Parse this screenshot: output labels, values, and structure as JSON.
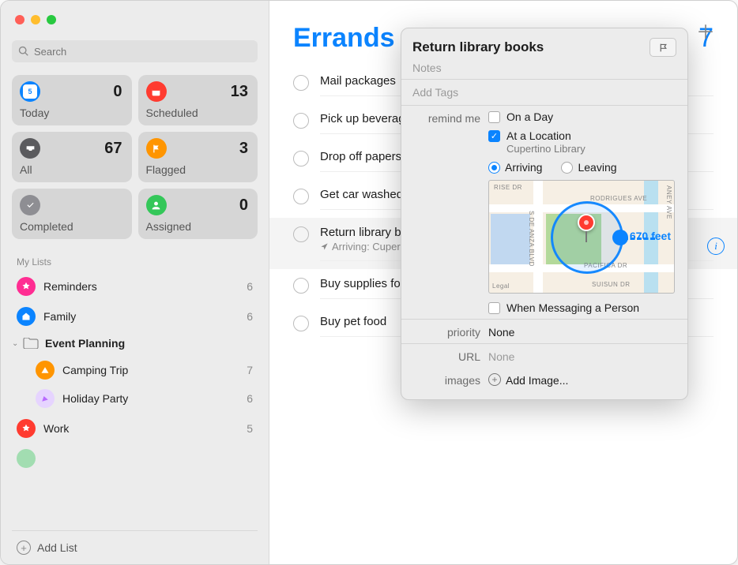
{
  "search": {
    "placeholder": "Search"
  },
  "smartLists": {
    "today": {
      "label": "Today",
      "count": "0"
    },
    "scheduled": {
      "label": "Scheduled",
      "count": "13"
    },
    "all": {
      "label": "All",
      "count": "67"
    },
    "flagged": {
      "label": "Flagged",
      "count": "3"
    },
    "completed": {
      "label": "Completed",
      "count": ""
    },
    "assigned": {
      "label": "Assigned",
      "count": "0"
    }
  },
  "sidebar": {
    "sectionLabel": "My Lists",
    "lists": {
      "reminders": {
        "name": "Reminders",
        "count": "6"
      },
      "family": {
        "name": "Family",
        "count": "6"
      },
      "camping": {
        "name": "Camping Trip",
        "count": "7"
      },
      "holiday": {
        "name": "Holiday Party",
        "count": "6"
      },
      "work": {
        "name": "Work",
        "count": "5"
      }
    },
    "folder": {
      "name": "Event Planning"
    },
    "addList": "Add List"
  },
  "main": {
    "title": "Errands",
    "count": "7",
    "tasks": {
      "t1": "Mail packages",
      "t2": "Pick up beverages",
      "t3": "Drop off papers",
      "t4": "Get car washed",
      "t5": "Return library books",
      "t5sub": "Arriving: Cupertino Library",
      "t6": "Buy supplies for trip",
      "t7": "Buy pet food"
    }
  },
  "popover": {
    "title": "Return library books",
    "notesPlaceholder": "Notes",
    "tagsPlaceholder": "Add Tags",
    "remindLabel": "remind me",
    "onDay": "On a Day",
    "atLocation": "At a Location",
    "locationName": "Cupertino Library",
    "arriving": "Arriving",
    "leaving": "Leaving",
    "distance": "670 feet",
    "roads": {
      "r1": "RISE DR",
      "r2": "RODRIGUES AVE",
      "r3": "PACIFICA DR",
      "r4": "S DE ANZA BLVD",
      "r5": "ANEY AVE",
      "r6": "SUISUN DR",
      "r7": "Legal"
    },
    "whenMessaging": "When Messaging a Person",
    "priorityLabel": "priority",
    "priorityValue": "None",
    "urlLabel": "URL",
    "urlValue": "None",
    "imagesLabel": "images",
    "addImage": "Add Image..."
  },
  "todayDate": "5"
}
